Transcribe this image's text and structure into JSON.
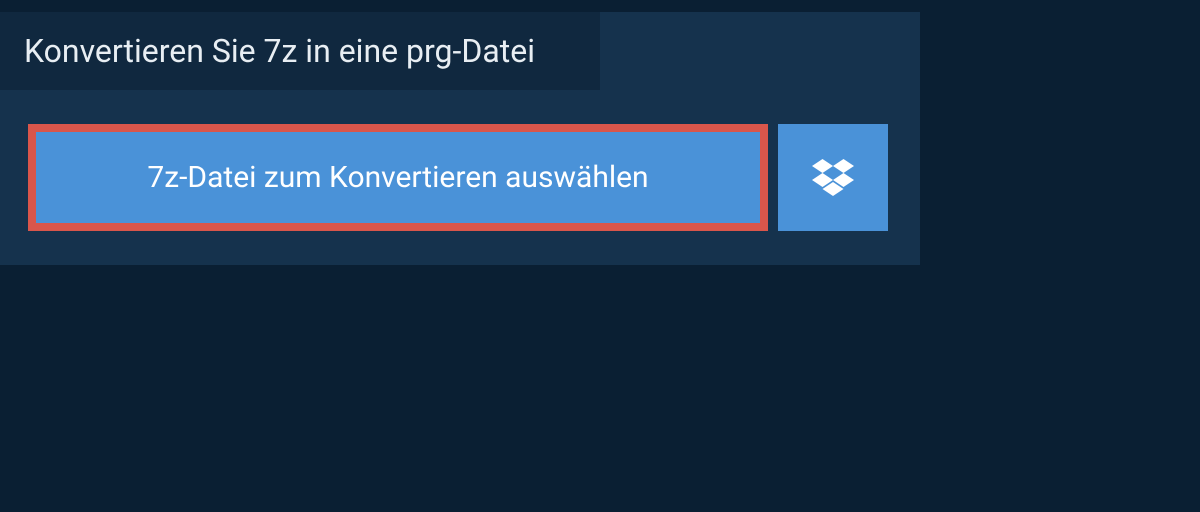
{
  "header": {
    "title": "Konvertieren Sie 7z in eine prg-Datei"
  },
  "upload": {
    "select_label": "7z-Datei zum Konvertieren auswählen"
  },
  "colors": {
    "page_bg": "#0a1f33",
    "panel_bg": "#15324d",
    "header_bg": "#10283f",
    "button_bg": "#4a92d8",
    "highlight_border": "#d9564b",
    "text_light": "#e8eef3",
    "button_text": "#ffffff"
  }
}
